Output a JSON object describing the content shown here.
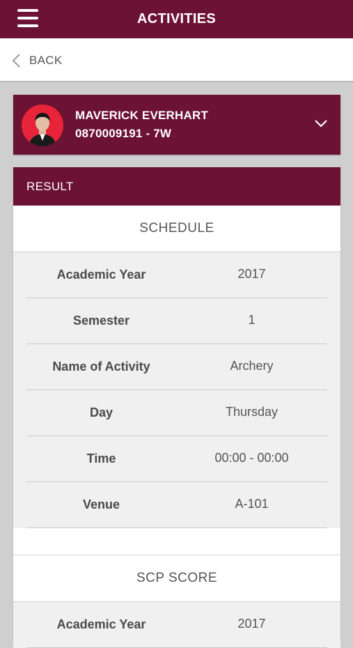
{
  "header": {
    "title": "ACTIVITIES"
  },
  "nav": {
    "back_label": "BACK"
  },
  "profile": {
    "name": "MAVERICK EVERHART",
    "id_line": "0870009191 - 7W"
  },
  "result": {
    "header": "RESULT",
    "schedule": {
      "title": "SCHEDULE",
      "rows": [
        {
          "label": "Academic Year",
          "value": "2017"
        },
        {
          "label": "Semester",
          "value": "1"
        },
        {
          "label": "Name of Activity",
          "value": "Archery"
        },
        {
          "label": "Day",
          "value": "Thursday"
        },
        {
          "label": "Time",
          "value": "00:00 - 00:00"
        },
        {
          "label": "Venue",
          "value": "A-101"
        }
      ]
    },
    "scp": {
      "title": "SCP SCORE",
      "rows": [
        {
          "label": "Academic Year",
          "value": "2017"
        }
      ]
    }
  },
  "colors": {
    "brand": "#6c1232",
    "avatar_bg": "#e8243a",
    "row_bg": "#f0f0f0"
  },
  "icons": [
    "menu-icon",
    "chevron-left-icon",
    "chevron-down-icon"
  ]
}
